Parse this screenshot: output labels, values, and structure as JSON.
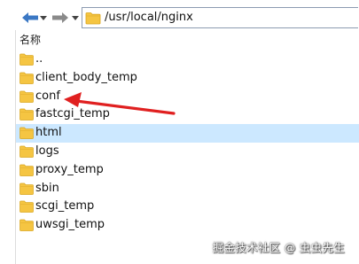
{
  "toolbar": {
    "back_icon": "left-arrow-icon",
    "forward_icon": "right-arrow-icon",
    "path": "/usr/local/nginx"
  },
  "list": {
    "column_header": "名称",
    "rows": [
      {
        "name": "..",
        "selected": false
      },
      {
        "name": "client_body_temp",
        "selected": false
      },
      {
        "name": "conf",
        "selected": false
      },
      {
        "name": "fastcgi_temp",
        "selected": false
      },
      {
        "name": "html",
        "selected": true
      },
      {
        "name": "logs",
        "selected": false
      },
      {
        "name": "proxy_temp",
        "selected": false
      },
      {
        "name": "sbin",
        "selected": false
      },
      {
        "name": "scgi_temp",
        "selected": false
      },
      {
        "name": "uwsgi_temp",
        "selected": false
      }
    ]
  },
  "annotation": {
    "color": "#e02020",
    "target": "conf"
  },
  "watermark": "掘金技术社区 @ 虫虫先生",
  "colors": {
    "folder": "#f5c542",
    "selection": "#cce8ff",
    "nav_arrow": "#3b78c4"
  }
}
